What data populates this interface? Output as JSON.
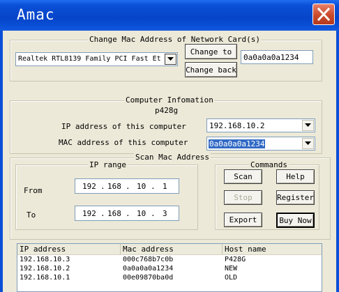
{
  "window": {
    "title": "Amac"
  },
  "change_mac": {
    "group_title": "Change Mac Address of Network Card(s)",
    "adapter_selected": "Realtek RTL8139 Family PCI Fast Et",
    "change_to_label": "Change to",
    "change_back_label": "Change back",
    "new_mac_value": "0a0a0a0a1234"
  },
  "computer_info": {
    "group_title": "Computer Infomation",
    "hostname": "p428g",
    "ip_label": "IP address of this computer",
    "ip_value": "192.168.10.2",
    "mac_label": "MAC address of this computer",
    "mac_value": "0a0a0a0a1234"
  },
  "scan": {
    "group_title": "Scan Mac Address",
    "ip_range": {
      "group_title": "IP range",
      "from_label": "From",
      "to_label": "To",
      "from": [
        "192",
        "168",
        "10",
        "1"
      ],
      "to": [
        "192",
        "168",
        "10",
        "3"
      ]
    },
    "commands": {
      "group_title": "Commands",
      "scan": "Scan",
      "help": "Help",
      "stop": "Stop",
      "register": "Register",
      "export": "Export",
      "buy_now": "Buy Now"
    }
  },
  "results": {
    "columns": [
      "IP address",
      "Mac address",
      "Host name"
    ],
    "rows": [
      [
        "192.168.10.3",
        "000c768b7c0b",
        "P428G"
      ],
      [
        "192.168.10.2",
        "0a0a0a0a1234",
        "NEW"
      ],
      [
        "192.168.10.1",
        "00e09870ba0d",
        "OLD"
      ]
    ]
  },
  "colors": {
    "title_bar": "#0a4fd6",
    "selection": "#316ac5",
    "face": "#ece9d8"
  }
}
